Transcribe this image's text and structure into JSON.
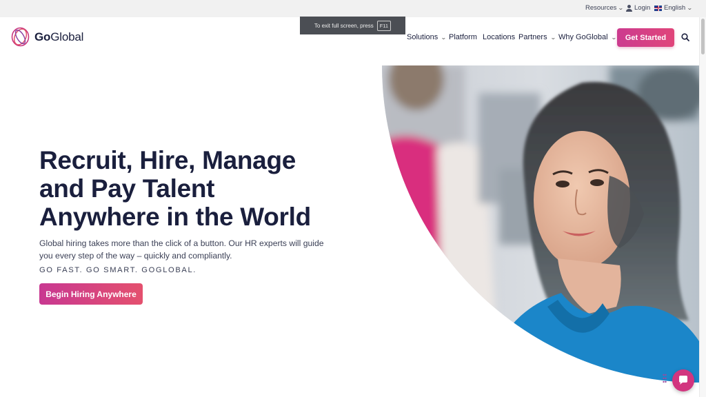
{
  "utility": {
    "resources": "Resources",
    "login": "Login",
    "language": "English"
  },
  "fullscreen_notice": {
    "text": "To exit full screen, press",
    "key": "F11"
  },
  "brand": {
    "name_bold": "Go",
    "name_rest": "Global",
    "accent": "#d2357f",
    "navy": "#1a1f3d"
  },
  "nav": {
    "items": [
      "Solutions",
      "Platform",
      "Locations",
      "Partners",
      "Why GoGlobal"
    ],
    "cta": "Get Started"
  },
  "hero": {
    "title_lines": [
      "Recruit, Hire, Manage",
      "and Pay Talent",
      "Anywhere in the World"
    ],
    "subtitle": "Global hiring takes more than the click of a button. Our HR experts will guide you every step of the way – quickly and compliantly.",
    "tagline": "GO FAST. GO SMART. GOGLOBAL.",
    "button": "Begin Hiring Anywhere"
  },
  "icons": {
    "search": "search-icon",
    "chat": "chat-icon",
    "user": "user-icon",
    "flag": "uk-flag-icon"
  }
}
